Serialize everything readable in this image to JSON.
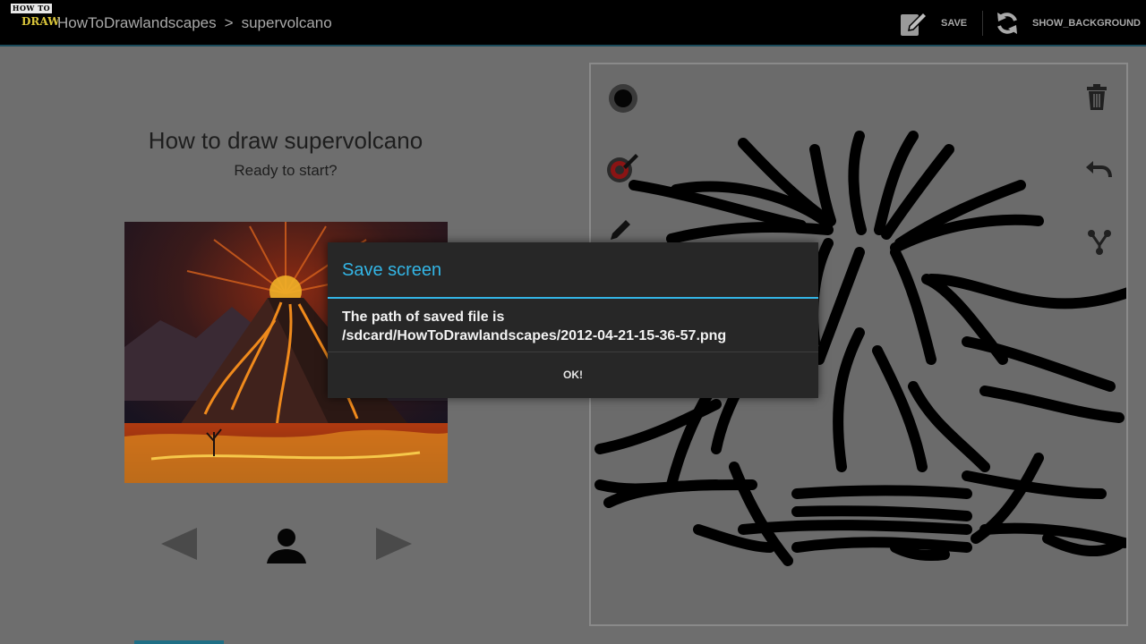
{
  "app": {
    "logo_top": "HOW TO",
    "logo_bottom": "DRAW",
    "breadcrumb_app": "HowToDrawlandscapes",
    "breadcrumb_sep": ">",
    "breadcrumb_page": "supervolcano"
  },
  "actions": {
    "save_label": "SAVE",
    "show_background_label": "SHOW_BACKGROUND"
  },
  "lesson": {
    "title": "How to draw supervolcano",
    "subtitle": "Ready to start?",
    "reference_image": "supervolcano-reference-image"
  },
  "nav_icons": [
    "previous-step-arrow",
    "person-icon",
    "next-step-arrow"
  ],
  "tools": {
    "left": [
      "brush-size-icon",
      "color-picker-icon",
      "pencil-icon"
    ],
    "right": [
      "trash-icon",
      "undo-icon",
      "share-icon"
    ]
  },
  "dialog": {
    "title": "Save screen",
    "message_line1": "The path of saved file is",
    "message_line2": "/sdcard/HowToDrawlandscapes/2012-04-21-15-36-57.png",
    "ok_label": "OK!"
  },
  "colors": {
    "accent": "#33b5e5",
    "dim_background": "#6e6e6e",
    "dialog_background": "#272727",
    "actionbar": "#000000"
  }
}
